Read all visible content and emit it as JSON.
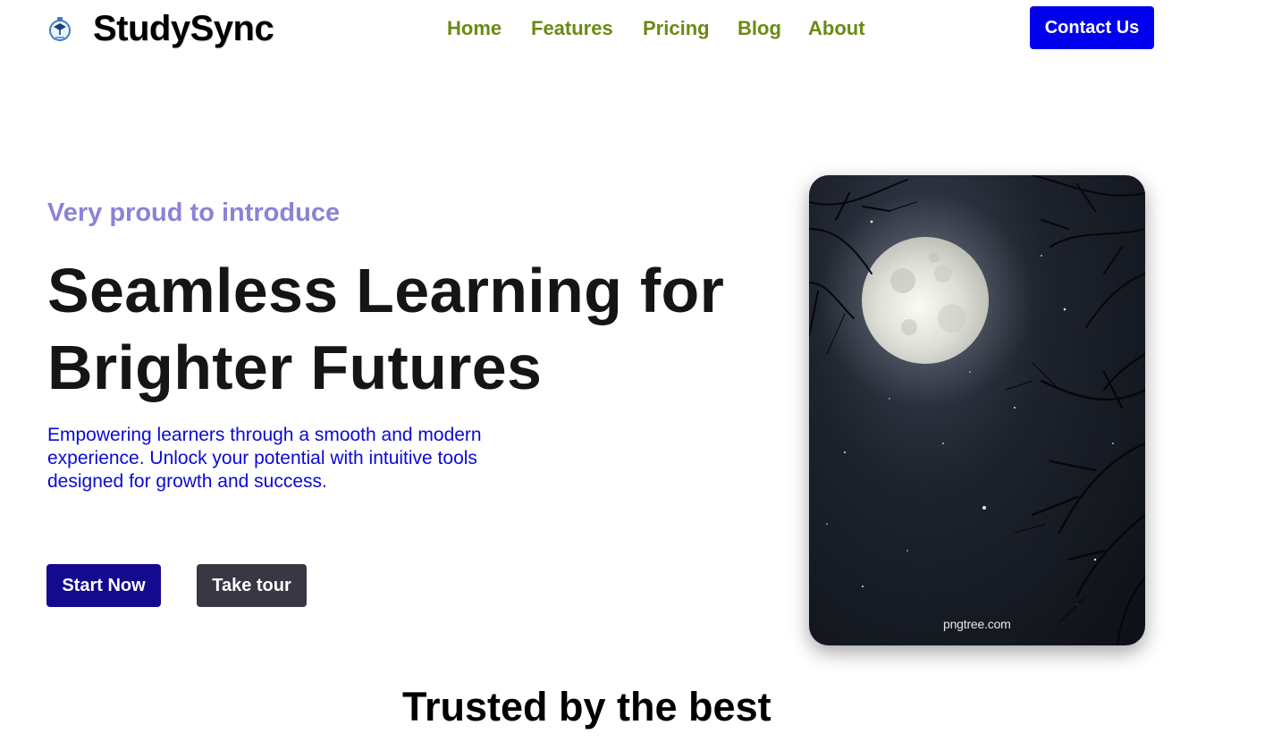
{
  "header": {
    "brand_name": "StudySync",
    "logo_icon": "graduation-stopwatch-icon",
    "nav": [
      {
        "label": "Home"
      },
      {
        "label": "Features"
      },
      {
        "label": "Pricing"
      },
      {
        "label": "Blog"
      },
      {
        "label": "About"
      }
    ],
    "contact_label": "Contact Us"
  },
  "hero": {
    "eyebrow": "Very proud to introduce",
    "title_line1": "Seamless Learning for",
    "title_line2": "Brighter Futures",
    "description": "Empowering learners through a smooth and modern experience. Unlock your potential with intuitive tools designed for growth and success.",
    "primary_button": "Start Now",
    "secondary_button": "Take tour",
    "image_watermark": "pngtree.com"
  },
  "trusted": {
    "title": "Trusted by the best"
  },
  "colors": {
    "nav_link": "#6b8a12",
    "contact_button": "#0000ee",
    "eyebrow": "#8b83d6",
    "description": "#0a0ad4",
    "start_button": "#130a8f",
    "tour_button": "#3a3744"
  }
}
